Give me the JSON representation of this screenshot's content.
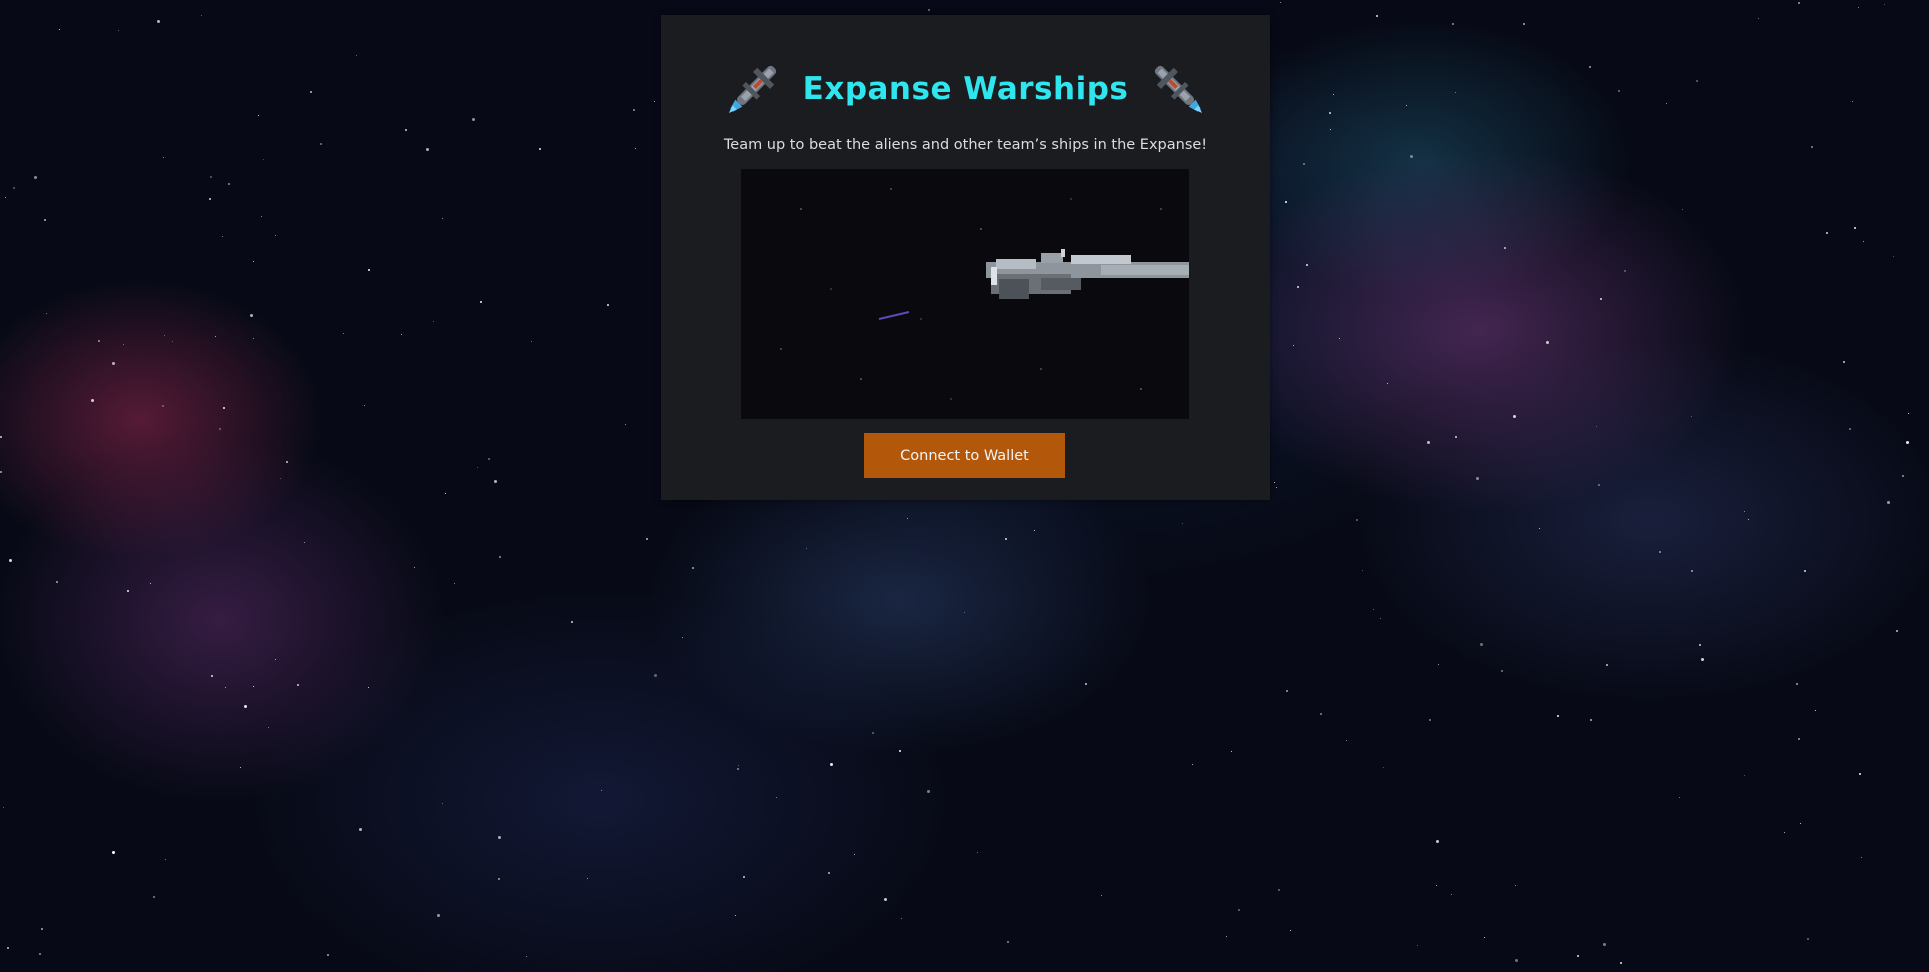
{
  "header": {
    "title": "Expanse Warships",
    "subtitle": "Team up to beat the aliens and other team’s ships in the Expanse!",
    "left_icon": "spaceship-icon",
    "right_icon": "spaceship-icon"
  },
  "hero": {
    "media": "warship-video"
  },
  "actions": {
    "connect_label": "Connect to Wallet"
  },
  "colors": {
    "title": "#2fe6ee",
    "panel": "#1b1c1f",
    "button": "#b3580a",
    "background": "#070a16"
  }
}
